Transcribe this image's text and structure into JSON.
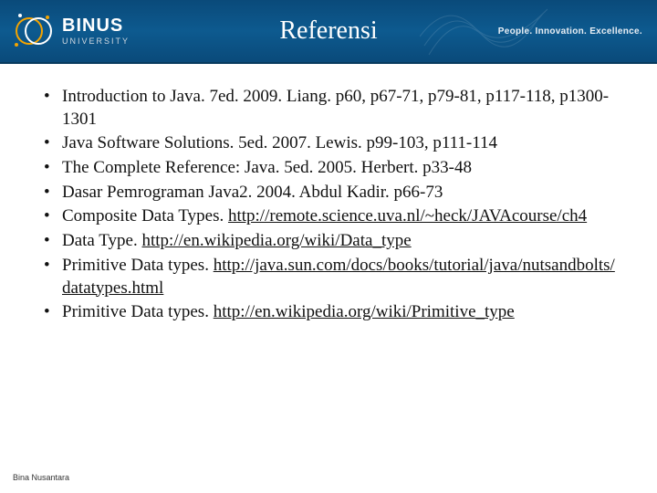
{
  "header": {
    "title": "Referensi",
    "logo_brand": "BINUS",
    "logo_sub": "UNIVERSITY",
    "tagline": "People. Innovation. Excellence."
  },
  "references": [
    {
      "text": "Introduction to Java. 7ed. 2009. Liang. p60, p67-71, p79-81, p117-118, p1300-1301",
      "link": ""
    },
    {
      "text": "Java Software Solutions. 5ed. 2007. Lewis. p99-103, p111-114",
      "link": ""
    },
    {
      "text": "The Complete Reference: Java. 5ed. 2005. Herbert. p33-48",
      "link": ""
    },
    {
      "text": "Dasar Pemrograman Java2. 2004. Abdul Kadir. p66-73",
      "link": ""
    },
    {
      "text": "Composite Data Types. ",
      "link": "http://remote.science.uva.nl/~heck/JAVAcourse/ch4"
    },
    {
      "text": "Data Type. ",
      "link": "http://en.wikipedia.org/wiki/Data_type"
    },
    {
      "text": "Primitive Data types. ",
      "link": "http://java.sun.com/docs/books/tutorial/java/nutsandbolts/datatypes.html"
    },
    {
      "text": "Primitive Data types. ",
      "link": "http://en.wikipedia.org/wiki/Primitive_type"
    }
  ],
  "footer": {
    "text": "Bina Nusantara"
  }
}
